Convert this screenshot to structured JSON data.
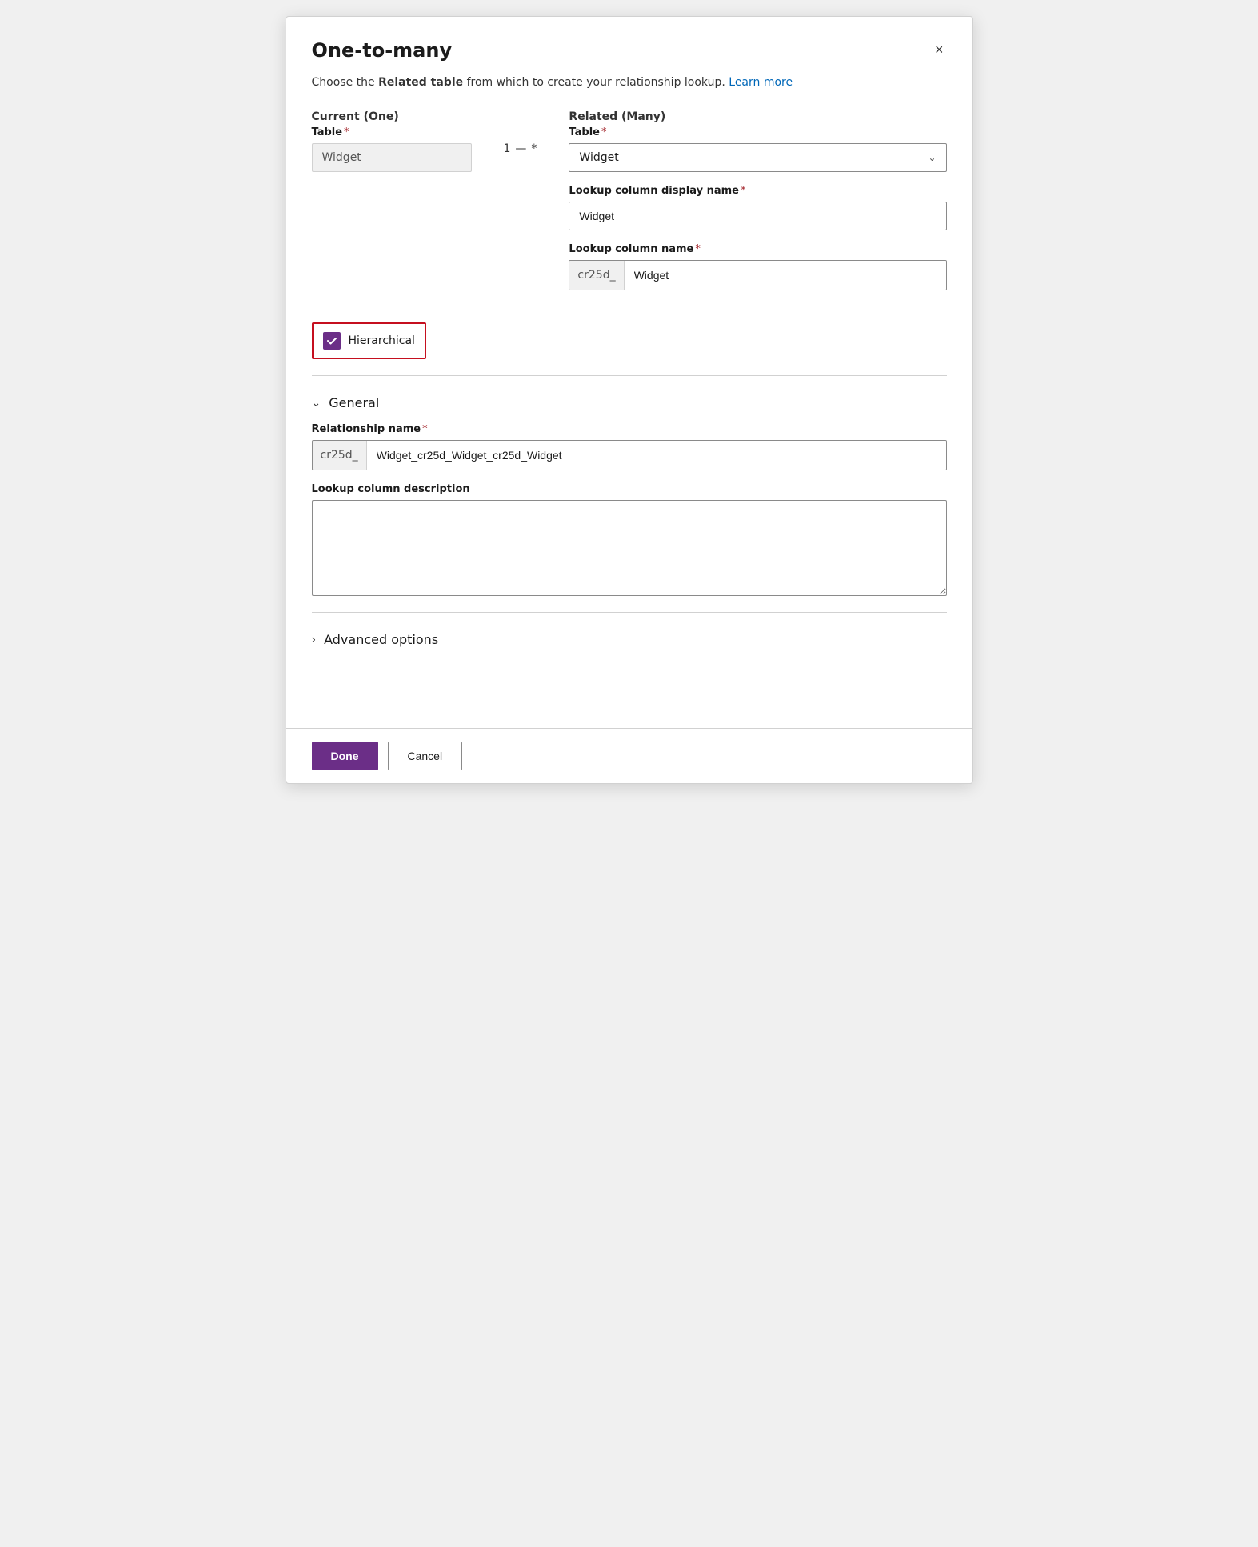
{
  "dialog": {
    "title": "One-to-many",
    "close_label": "×",
    "description_text": "Choose the ",
    "description_bold": "Related table",
    "description_text2": " from which to create your relationship lookup. ",
    "learn_more_label": "Learn more"
  },
  "current_section": {
    "heading": "Current (One)",
    "table_label": "Table",
    "required": "*",
    "table_value": "Widget"
  },
  "connector": {
    "one": "1",
    "dash": "—",
    "many": "*"
  },
  "related_section": {
    "heading": "Related (Many)",
    "table_label": "Table",
    "required": "*",
    "table_value": "Widget",
    "lookup_display_label": "Lookup column display name",
    "lookup_display_required": "*",
    "lookup_display_value": "Widget",
    "lookup_name_label": "Lookup column name",
    "lookup_name_required": "*",
    "lookup_name_prefix": "cr25d_",
    "lookup_name_value": "Widget"
  },
  "hierarchical": {
    "label": "Hierarchical",
    "checked": true
  },
  "general_section": {
    "heading": "General",
    "chevron": "∨",
    "relationship_name_label": "Relationship name",
    "relationship_name_required": "*",
    "relationship_name_prefix": "cr25d_",
    "relationship_name_value": "Widget_cr25d_Widget_cr25d_Widget",
    "description_label": "Lookup column description",
    "description_value": ""
  },
  "advanced_section": {
    "heading": "Advanced options",
    "chevron": "›"
  },
  "footer": {
    "done_label": "Done",
    "cancel_label": "Cancel"
  }
}
